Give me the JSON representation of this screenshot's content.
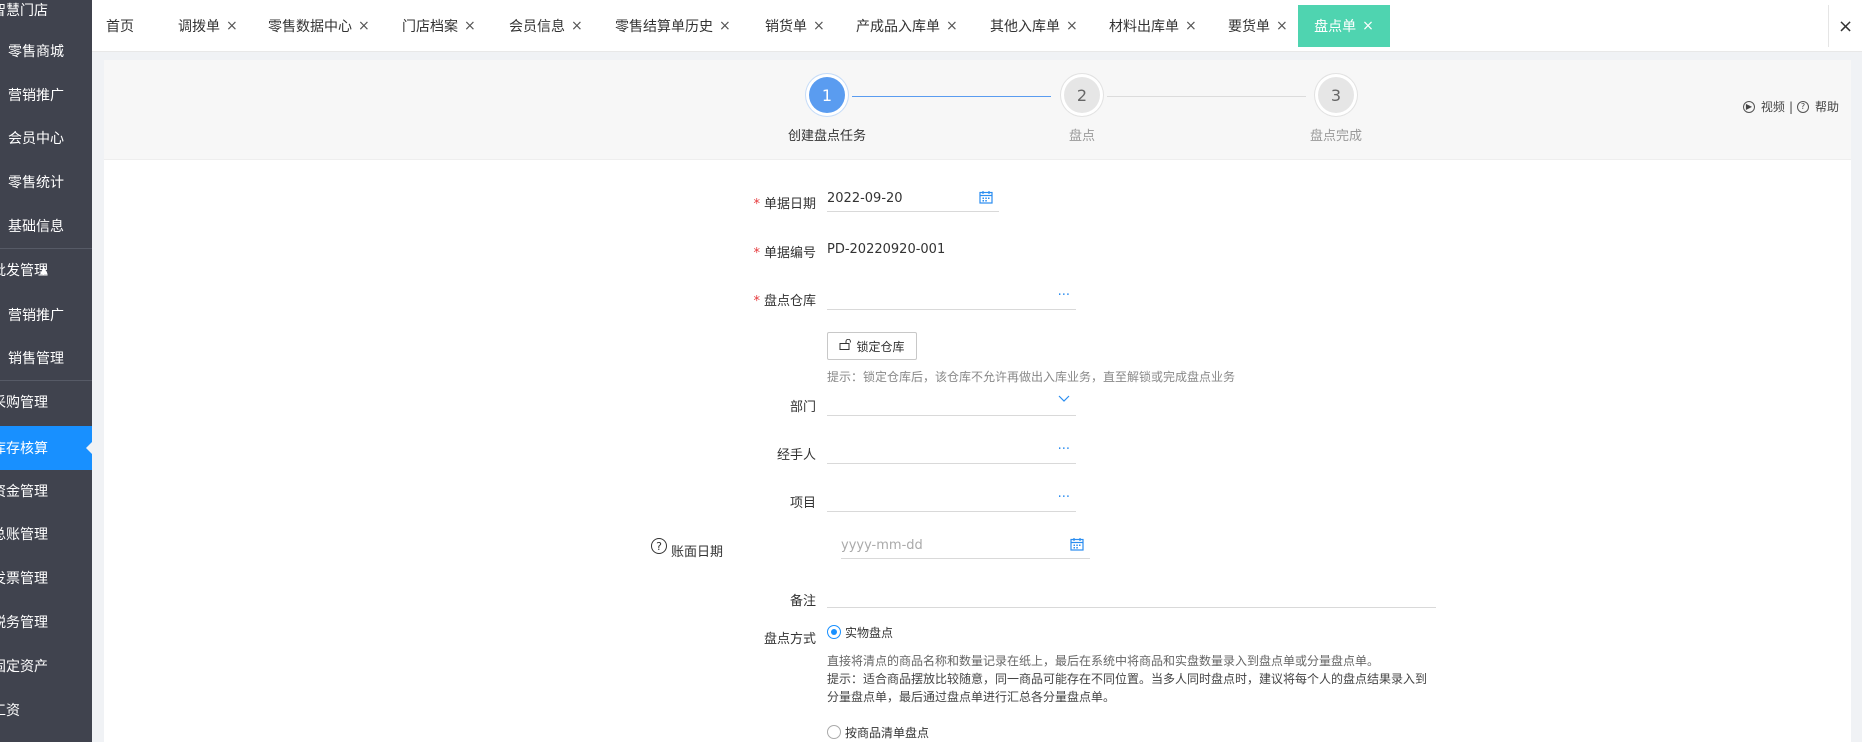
{
  "sidebar": {
    "items": [
      {
        "label": "智慧门店"
      },
      {
        "label": "零售商城"
      },
      {
        "label": "营销推广"
      },
      {
        "label": "会员中心"
      },
      {
        "label": "零售统计"
      },
      {
        "label": "基础信息"
      },
      {
        "label": "批发管理"
      },
      {
        "label": "营销推广"
      },
      {
        "label": "销售管理"
      },
      {
        "label": "采购管理"
      },
      {
        "label": "库存核算"
      },
      {
        "label": "资金管理"
      },
      {
        "label": "总账管理"
      },
      {
        "label": "发票管理"
      },
      {
        "label": "税务管理"
      },
      {
        "label": "固定资产"
      },
      {
        "label": "工资"
      }
    ],
    "active_color": "#1890ff",
    "bg_color": "#40434e"
  },
  "tabs": [
    {
      "label": "首页"
    },
    {
      "label": "调拨单"
    },
    {
      "label": "零售数据中心"
    },
    {
      "label": "门店档案"
    },
    {
      "label": "会员信息"
    },
    {
      "label": "零售结算单历史"
    },
    {
      "label": "销货单"
    },
    {
      "label": "产成品入库单"
    },
    {
      "label": "其他入库单"
    },
    {
      "label": "材料出库单"
    },
    {
      "label": "要货单"
    },
    {
      "label": "盘点单"
    }
  ],
  "tab_close_glyph": "×",
  "active_tab_color": "#4fd4b0",
  "steps": [
    {
      "number": "1",
      "label": "创建盘点任务"
    },
    {
      "number": "2",
      "label": "盘点"
    },
    {
      "number": "3",
      "label": "盘点完成"
    }
  ],
  "help": {
    "video": "视频",
    "separator": "|",
    "help": "帮助"
  },
  "form": {
    "required_mark": "*",
    "date_label": "单据日期",
    "date_value": "2022-09-20",
    "code_label": "单据编号",
    "code_value": "PD-20220920-001",
    "warehouse_label": "盘点仓库",
    "lock_button": "锁定仓库",
    "lock_hint": "提示：锁定仓库后，该仓库不允许再做出入库业务，直至解锁或完成盘点业务",
    "dept_label": "部门",
    "handler_label": "经手人",
    "project_label": "项目",
    "book_date_label": "账面日期",
    "book_date_placeholder": "yyyy-mm-dd",
    "remark_label": "备注",
    "method_label": "盘点方式",
    "method_option1": "实物盘点",
    "method_desc1": "直接将清点的商品名称和数量记录在纸上，最后在系统中将商品和实盘数量录入到盘点单或分量盘点单。",
    "method_desc2": "提示：适合商品摆放比较随意，同一商品可能存在不同位置。当多人同时盘点时，建议将每个人的盘点结果录入到",
    "method_desc3": "分量盘点单，最后通过盘点单进行汇总各分量盘点单。",
    "method_option2": "按商品清单盘点",
    "ellipsis_glyph": "···",
    "help_glyph": "?"
  }
}
